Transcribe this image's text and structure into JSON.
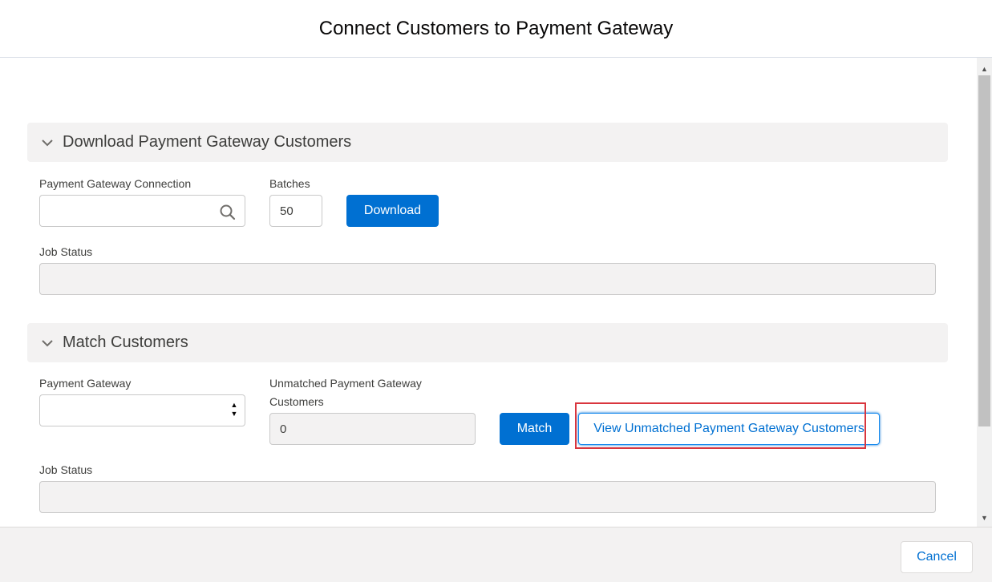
{
  "modal": {
    "title": "Connect Customers to Payment Gateway"
  },
  "download_section": {
    "title": "Download Payment Gateway Customers",
    "connection_label": "Payment Gateway Connection",
    "connection_value": "",
    "batches_label": "Batches",
    "batches_value": "50",
    "download_button": "Download",
    "job_status_label": "Job Status",
    "job_status_value": ""
  },
  "match_section": {
    "title": "Match Customers",
    "gateway_label": "Payment Gateway",
    "gateway_value": "",
    "unmatched_label_line1": "Unmatched Payment Gateway",
    "unmatched_label_line2": "Customers",
    "unmatched_value": "0",
    "match_button": "Match",
    "view_unmatched_button": "View Unmatched Payment Gateway Customers",
    "job_status_label": "Job Status",
    "job_status_value": ""
  },
  "footer": {
    "cancel_button": "Cancel"
  },
  "colors": {
    "brand": "#0070d2",
    "section_bg": "#f3f2f2",
    "highlight": "#d9363e"
  },
  "icons": {
    "section_toggle": "chevron-down-icon",
    "lookup": "search-icon",
    "select": "select-arrows-icon"
  }
}
